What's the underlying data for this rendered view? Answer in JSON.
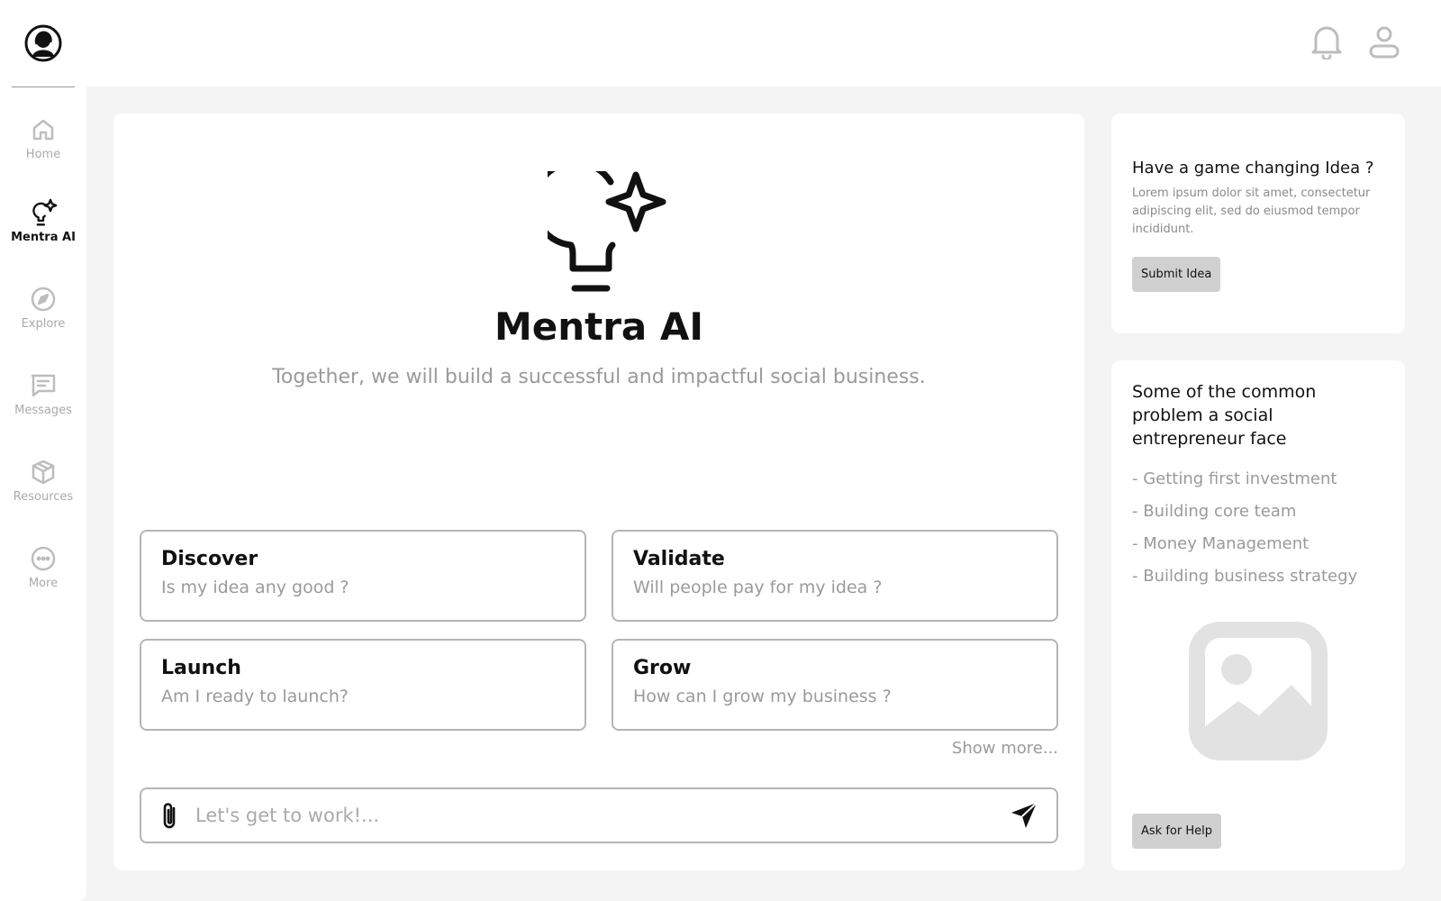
{
  "header": {
    "logo_icon": "profile-logo-icon",
    "notification_icon": "bell-icon",
    "user_icon": "user-icon"
  },
  "sidebar": {
    "items": [
      {
        "label": "Home",
        "icon": "home-icon",
        "active": false
      },
      {
        "label": "Mentra AI",
        "icon": "lightbulb-sparkle-icon",
        "active": true
      },
      {
        "label": "Explore",
        "icon": "compass-icon",
        "active": false
      },
      {
        "label": "Messages",
        "icon": "message-icon",
        "active": false
      },
      {
        "label": "Resources",
        "icon": "cube-icon",
        "active": false
      },
      {
        "label": "More",
        "icon": "more-icon",
        "active": false
      }
    ]
  },
  "main": {
    "hero_icon": "lightbulb-sparkle-icon",
    "title": "Mentra AI",
    "subtitle": "Together, we will build a successful and impactful social business.",
    "prompt_cards": [
      {
        "title": "Discover",
        "subtitle": "Is my idea any good ?"
      },
      {
        "title": "Validate",
        "subtitle": "Will people pay for my idea ?"
      },
      {
        "title": "Launch",
        "subtitle": "Am I ready to launch?"
      },
      {
        "title": "Grow",
        "subtitle": "How can I grow my business ?"
      }
    ],
    "show_more": "Show more...",
    "chat": {
      "placeholder": "Let's get to work!...",
      "value": "",
      "attach_icon": "paperclip-icon",
      "send_icon": "send-icon"
    }
  },
  "idea_panel": {
    "heading": "Have a game changing Idea ?",
    "body": "Lorem ipsum dolor sit amet, consectetur adipiscing elit, sed do eiusmod tempor incididunt.",
    "button": "Submit Idea"
  },
  "problems_panel": {
    "heading": "Some of the common problem a social entrepreneur face",
    "items": [
      "- Getting first investment",
      "- Building core team",
      "- Money Management",
      "- Building business strategy"
    ],
    "image_icon": "image-placeholder-icon",
    "button": "Ask for Help"
  },
  "colors": {
    "background": "#f4f4f4",
    "surface": "#ffffff",
    "text_primary": "#111111",
    "text_muted": "#9a9a9a",
    "border": "#b5b5b5",
    "button_grey": "#d0d0d0"
  }
}
